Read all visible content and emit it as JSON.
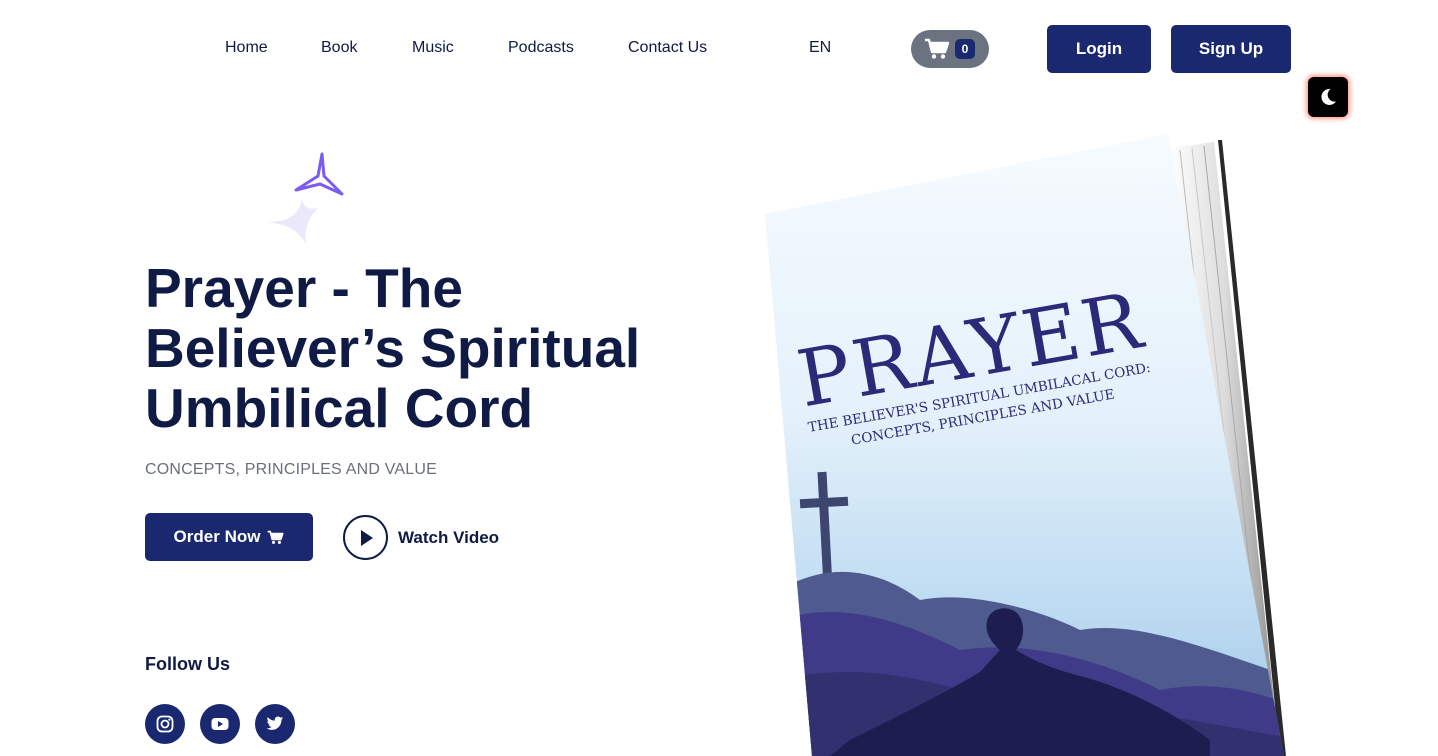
{
  "nav": {
    "links": [
      "Home",
      "Book",
      "Music",
      "Podcasts",
      "Contact Us"
    ],
    "language": "EN",
    "cart_count": "0",
    "login_label": "Login",
    "signup_label": "Sign Up"
  },
  "hero": {
    "title": "Prayer - The Believer’s Spiritual Umbilical Cord",
    "subtitle": "CONCEPTS, PRINCIPLES AND VALUE",
    "order_label": "Order Now",
    "watch_label": "Watch Video",
    "follow_label": "Follow Us"
  },
  "social": [
    "instagram-icon",
    "youtube-icon",
    "twitter-icon"
  ],
  "book_cover": {
    "title": "PRAYER",
    "subtitle_line1": "THE BELIEVER'S SPIRITUAL UMBILACAL CORD:",
    "subtitle_line2": "CONCEPTS, PRINCIPLES AND VALUE"
  },
  "colors": {
    "navy": "#1a2870",
    "heading": "#0f1a45",
    "cart_bg": "#6b7380",
    "muted_text": "#6b6f7c"
  }
}
